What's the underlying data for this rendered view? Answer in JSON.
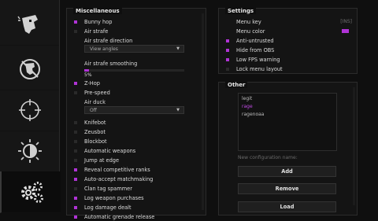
{
  "tabs": [
    {
      "name": "ragebot-icon"
    },
    {
      "name": "antiaim-icon"
    },
    {
      "name": "crosshair-icon"
    },
    {
      "name": "visuals-icon"
    },
    {
      "name": "settings-gears-icon"
    }
  ],
  "misc": {
    "title": "Miscellaneous",
    "bunny_hop": "Bunny hop",
    "air_strafe": "Air strafe",
    "air_strafe_direction": "Air strafe direction",
    "air_strafe_direction_value": "View angles",
    "air_strafe_smoothing": "Air strafe smoothing",
    "air_strafe_smoothing_value": "5%",
    "z_hop": "Z-Hop",
    "pre_speed": "Pre-speed",
    "air_duck": "Air duck",
    "air_duck_value": "Off",
    "knifebot": "Knifebot",
    "zeusbot": "Zeusbot",
    "blockbot": "Blockbot",
    "automatic_weapons": "Automatic weapons",
    "jump_at_edge": "Jump at edge",
    "reveal_ranks": "Reveal competitive ranks",
    "auto_accept": "Auto-accept matchmaking",
    "clan_tag": "Clan tag spammer",
    "log_purchases": "Log weapon purchases",
    "log_damage": "Log damage dealt",
    "auto_grenade": "Automatic grenade release"
  },
  "settings": {
    "title": "Settings",
    "menu_key": "Menu key",
    "menu_key_value": "[INS]",
    "menu_color": "Menu color",
    "anti_untrusted": "Anti-untrusted",
    "hide_obs": "Hide from OBS",
    "low_fps": "Low FPS warning",
    "lock_layout": "Lock menu layout"
  },
  "other": {
    "title": "Other",
    "configs": [
      "legit",
      "rage",
      "ragenoaa"
    ],
    "new_config_label": "New configuration name:",
    "add": "Add",
    "remove": "Remove",
    "load": "Load"
  },
  "colors": {
    "accent": "#b033d6"
  }
}
